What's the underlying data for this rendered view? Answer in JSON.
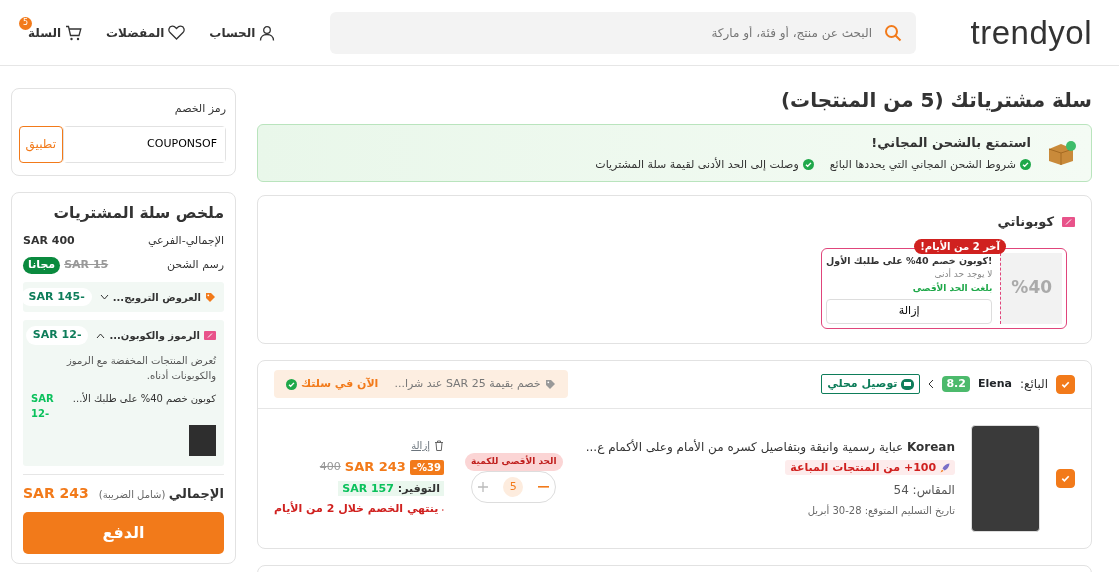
{
  "header": {
    "logo": "trendyol",
    "search_placeholder": "البحث عن منتج، أو فئة، أو ماركة",
    "account": "الحساب",
    "favorites": "المفضلات",
    "cart": "السلة",
    "cart_count": "5"
  },
  "page_title": "سلة مشترياتك (5 من المنتجات)",
  "free_shipping": {
    "title": "استمتع بالشحن المجاني!",
    "conditions": [
      {
        "text": "شروط الشحن المجاني التي يحددها البائع",
        "checked": true
      },
      {
        "text": "وصلت إلى الحد الأدنى لقيمة سلة المشتريات",
        "checked": true
      }
    ]
  },
  "coupons": {
    "title": "كوبوناتي",
    "items": [
      {
        "value": "%40",
        "badge": "آخر 2 من الأيام!",
        "title": "!كوبون خصم 40% على طلبك الأول",
        "minimum": "لا يوجد حد أدنى",
        "limit": "بلغت الحد الأقصى",
        "remove": "إزالة"
      }
    ]
  },
  "seller": {
    "checked": true,
    "label": "البائع:",
    "name": "Elena",
    "rating": "8.2",
    "delivery": "توصيل محلي",
    "promo": "خصم بقيمة 25 SAR عند شرا...",
    "promo_status": "الآن في سلتك"
  },
  "items": [
    {
      "checked": true,
      "brand": "Korean",
      "name": "عباية رسمية وانيقة وبتفاصيل كسره من الأمام وعلى الأكمام ع...",
      "sold": "100+ من المنتجات المباعة",
      "size": "المقاس: 54",
      "delivery": "تاريخ التسليم المتوقع: 28-30 أبريل",
      "qty_limit": "الحد الأقصى للكمية",
      "qty": "5",
      "remove": "إزالة",
      "discount": "%39-",
      "price": "SAR 243",
      "old_price": "400",
      "savings_label": "التوفير:",
      "savings": "SAR 157",
      "expiry": "ينتهي الخصم خلال 2 من الأيام"
    }
  ],
  "coupon_code": {
    "label": "رمز الخصم",
    "value": "COUPONSOF",
    "apply": "تطبيق"
  },
  "summary": {
    "title": "ملخص سلة المشتريات",
    "subtotal_label": "الإجمالي-الفرعي",
    "subtotal": "SAR 400",
    "shipping_label": "رسم الشحن",
    "shipping_old": "SAR 15",
    "shipping_badge": "مجانا",
    "groups": [
      {
        "kind": "promo",
        "label": "العروض الترويج...",
        "amount": "SAR 145-",
        "expanded": false
      },
      {
        "kind": "coupon",
        "label": "الرموز والكوبون...",
        "amount": "SAR 12-",
        "expanded": true,
        "note": "تُعرض المنتجات المخفضة مع الرموز والكوبونات أدناه.",
        "lines": [
          {
            "text": "كوبون خصم 40% على طلبك الأ...",
            "amount": "SAR 12-"
          }
        ]
      }
    ],
    "total_label": "الإجمالي",
    "total_note": "(شامل الضريبة)",
    "total": "SAR 243",
    "pay": "الدفع"
  }
}
